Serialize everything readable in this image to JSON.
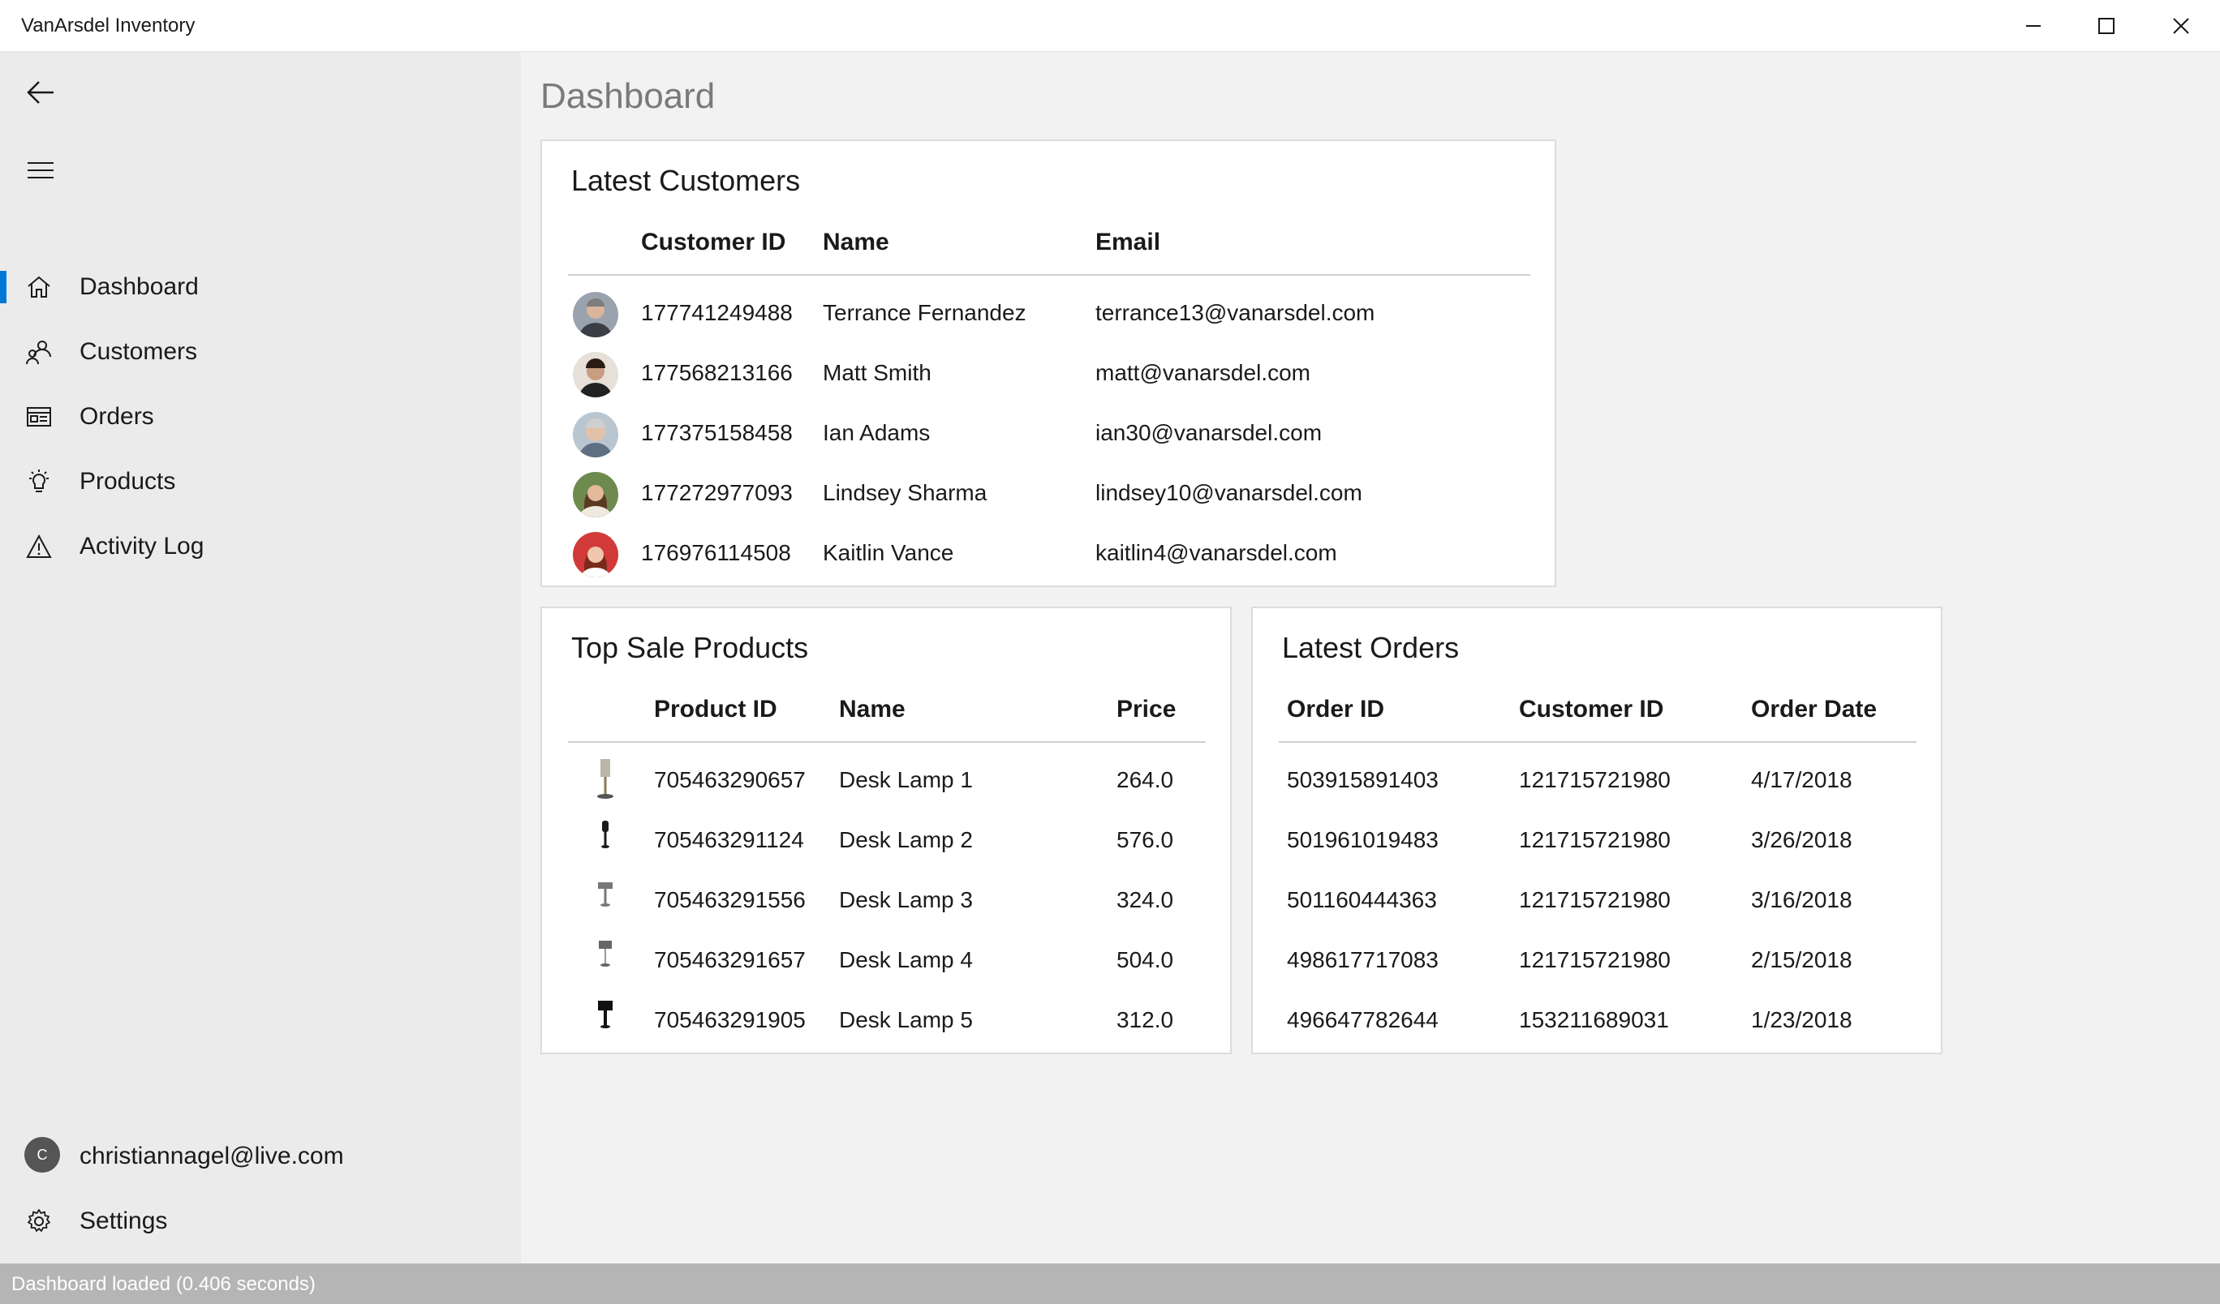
{
  "window": {
    "title": "VanArsdel Inventory"
  },
  "sidebar": {
    "items": [
      {
        "label": "Dashboard",
        "icon": "home-icon",
        "selected": true
      },
      {
        "label": "Customers",
        "icon": "people-icon",
        "selected": false
      },
      {
        "label": "Orders",
        "icon": "orders-icon",
        "selected": false
      },
      {
        "label": "Products",
        "icon": "lightbulb-icon",
        "selected": false
      },
      {
        "label": "Activity Log",
        "icon": "warning-icon",
        "selected": false
      }
    ],
    "account": {
      "initial": "C",
      "email": "christiannagel@live.com"
    },
    "settings_label": "Settings"
  },
  "main": {
    "page_title": "Dashboard",
    "customers": {
      "title": "Latest Customers",
      "headers": [
        "Customer ID",
        "Name",
        "Email"
      ],
      "rows": [
        {
          "id": "177741249488",
          "name": "Terrance Fernandez",
          "email": "terrance13@vanarsdel.com"
        },
        {
          "id": "177568213166",
          "name": "Matt Smith",
          "email": "matt@vanarsdel.com"
        },
        {
          "id": "177375158458",
          "name": "Ian Adams",
          "email": "ian30@vanarsdel.com"
        },
        {
          "id": "177272977093",
          "name": "Lindsey Sharma",
          "email": "lindsey10@vanarsdel.com"
        },
        {
          "id": "176976114508",
          "name": "Kaitlin Vance",
          "email": "kaitlin4@vanarsdel.com"
        }
      ]
    },
    "products": {
      "title": "Top Sale Products",
      "headers": [
        "Product ID",
        "Name",
        "Price"
      ],
      "rows": [
        {
          "id": "705463290657",
          "name": "Desk Lamp 1",
          "price": "264.0"
        },
        {
          "id": "705463291124",
          "name": "Desk Lamp 2",
          "price": "576.0"
        },
        {
          "id": "705463291556",
          "name": "Desk Lamp 3",
          "price": "324.0"
        },
        {
          "id": "705463291657",
          "name": "Desk Lamp 4",
          "price": "504.0"
        },
        {
          "id": "705463291905",
          "name": "Desk Lamp 5",
          "price": "312.0"
        }
      ]
    },
    "orders": {
      "title": "Latest Orders",
      "headers": [
        "Order ID",
        "Customer ID",
        "Order Date"
      ],
      "rows": [
        {
          "id": "503915891403",
          "customer_id": "121715721980",
          "date": "4/17/2018"
        },
        {
          "id": "501961019483",
          "customer_id": "121715721980",
          "date": "3/26/2018"
        },
        {
          "id": "501160444363",
          "customer_id": "121715721980",
          "date": "3/16/2018"
        },
        {
          "id": "498617717083",
          "customer_id": "121715721980",
          "date": "2/15/2018"
        },
        {
          "id": "496647782644",
          "customer_id": "153211689031",
          "date": "1/23/2018"
        }
      ]
    }
  },
  "status": {
    "text": "Dashboard loaded (0.406 seconds)"
  },
  "colors": {
    "accent": "#0078d7",
    "sidebar_bg": "#ebebeb",
    "content_bg": "#f2f2f2",
    "status_bg": "#b5b5b5"
  }
}
